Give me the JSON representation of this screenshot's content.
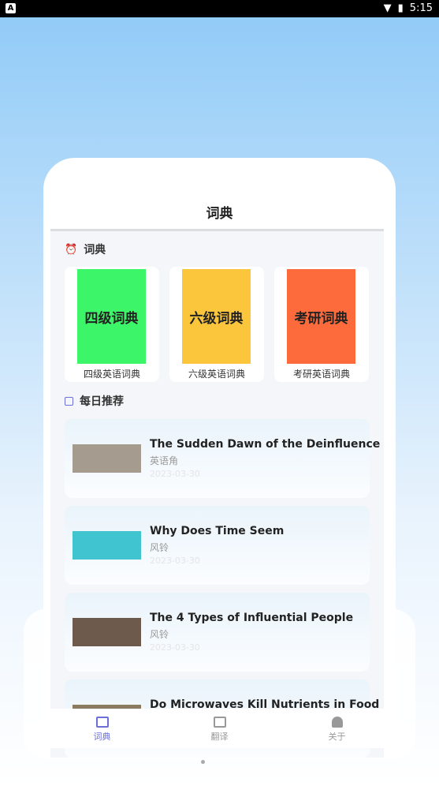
{
  "status": {
    "time": "5:15"
  },
  "header": {
    "title": "词典"
  },
  "dict_section": {
    "title": "词典",
    "items": [
      {
        "cover": "四级词典",
        "label": "四级英语词典",
        "color": "#3df568"
      },
      {
        "cover": "六级词典",
        "label": "六级英语词典",
        "color": "#fcc63c"
      },
      {
        "cover": "考研词典",
        "label": "考研英语词典",
        "color": "#fd6b3d"
      }
    ]
  },
  "daily_section": {
    "title": "每日推荐",
    "articles": [
      {
        "title": "The Sudden Dawn of the Deinfluence",
        "source": "英语角",
        "date": "2023-03-30",
        "thumb": "#a59b8f"
      },
      {
        "title": "Why Does Time Seem",
        "source": "风铃",
        "date": "2023-03-30",
        "thumb": "#40c4d0"
      },
      {
        "title": "The 4 Types of Influential People",
        "source": "风铃",
        "date": "2023-03-30",
        "thumb": "#6e5a4c"
      },
      {
        "title": "Do Microwaves Kill Nutrients in Food",
        "source": "",
        "date": "",
        "thumb": "#8a7a60"
      }
    ]
  },
  "nav": {
    "items": [
      {
        "label": "词典",
        "icon": "dictionary-icon",
        "active": true
      },
      {
        "label": "翻译",
        "icon": "translate-icon"
      },
      {
        "label": "关于",
        "icon": "person-icon"
      }
    ]
  },
  "colors": {
    "accent": "#6b6fd6"
  }
}
